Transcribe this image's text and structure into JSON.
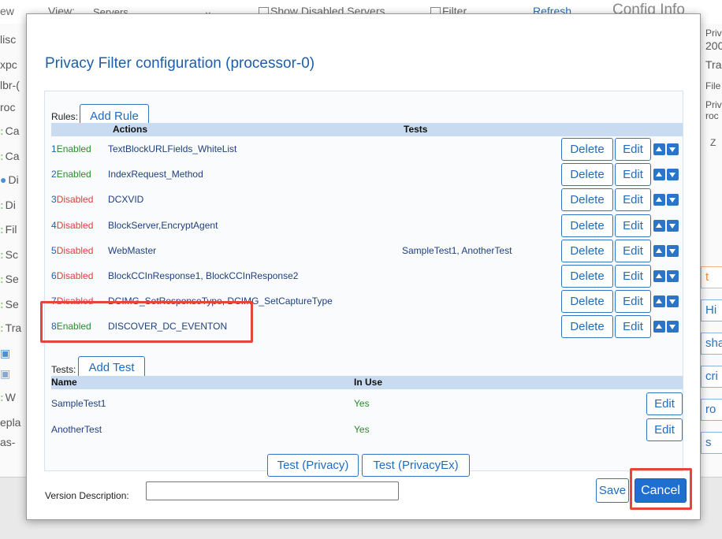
{
  "background": {
    "toolbar": {
      "left_fragment": "ew",
      "view_label": "View:",
      "view_value": "Servers",
      "show_disabled": "Show Disabled Servers",
      "filter": "Filter",
      "refresh": "Refresh",
      "config_info": "Config Info"
    },
    "left_items": [
      "lisc",
      "xpc",
      "lbr-(",
      "roc",
      "Ca",
      "Ca",
      "Di",
      "Di",
      "Fil",
      "Sc",
      "Se",
      "Se",
      "Tra",
      "",
      "",
      "W",
      "epla",
      "as-"
    ],
    "right_items": [
      "Priv",
      "200",
      "Tra",
      "File",
      "Priv",
      "roc",
      "Z"
    ],
    "right_buttons": [
      "t",
      "Hi",
      "sha",
      "cri",
      "ro",
      "s"
    ]
  },
  "dialog": {
    "title": "Privacy Filter configuration (processor-0)",
    "rules": {
      "label": "Rules:",
      "add_label": "Add Rule",
      "col_actions": "Actions",
      "col_tests": "Tests",
      "items": [
        {
          "index": "1",
          "status": "Enabled",
          "actions": "TextBlockURLFields_WhiteList",
          "tests": ""
        },
        {
          "index": "2",
          "status": "Enabled",
          "actions": "IndexRequest_Method",
          "tests": ""
        },
        {
          "index": "3",
          "status": "Disabled",
          "actions": "DCXVID",
          "tests": ""
        },
        {
          "index": "4",
          "status": "Disabled",
          "actions": "BlockServer,EncryptAgent",
          "tests": ""
        },
        {
          "index": "5",
          "status": "Disabled",
          "actions": "WebMaster",
          "tests": "SampleTest1, AnotherTest"
        },
        {
          "index": "6",
          "status": "Disabled",
          "actions": "BlockCCInResponse1, BlockCCInResponse2",
          "tests": ""
        },
        {
          "index": "7",
          "status": "Disabled",
          "actions": "DCIMG_SetResponseType, DCIMG_SetCaptureType",
          "tests": ""
        },
        {
          "index": "8",
          "status": "Enabled",
          "actions": "DISCOVER_DC_EVENTON",
          "tests": ""
        }
      ],
      "delete_label": "Delete",
      "edit_label": "Edit"
    },
    "tests": {
      "label": "Tests:",
      "add_label": "Add Test",
      "col_name": "Name",
      "col_in_use": "In Use",
      "items": [
        {
          "name": "SampleTest1",
          "in_use": "Yes"
        },
        {
          "name": "AnotherTest",
          "in_use": "Yes"
        }
      ],
      "edit_label": "Edit"
    },
    "test_privacy_label": "Test (Privacy)",
    "test_privacyex_label": "Test (PrivacyEx)",
    "version_description_label": "Version Description:",
    "version_description_value": "",
    "save_label": "Save",
    "cancel_label": "Cancel"
  },
  "colors": {
    "accent": "#1f6fd0",
    "enabled": "#2a8a2a",
    "disabled": "#e23b3b",
    "highlight": "#e5453a"
  }
}
